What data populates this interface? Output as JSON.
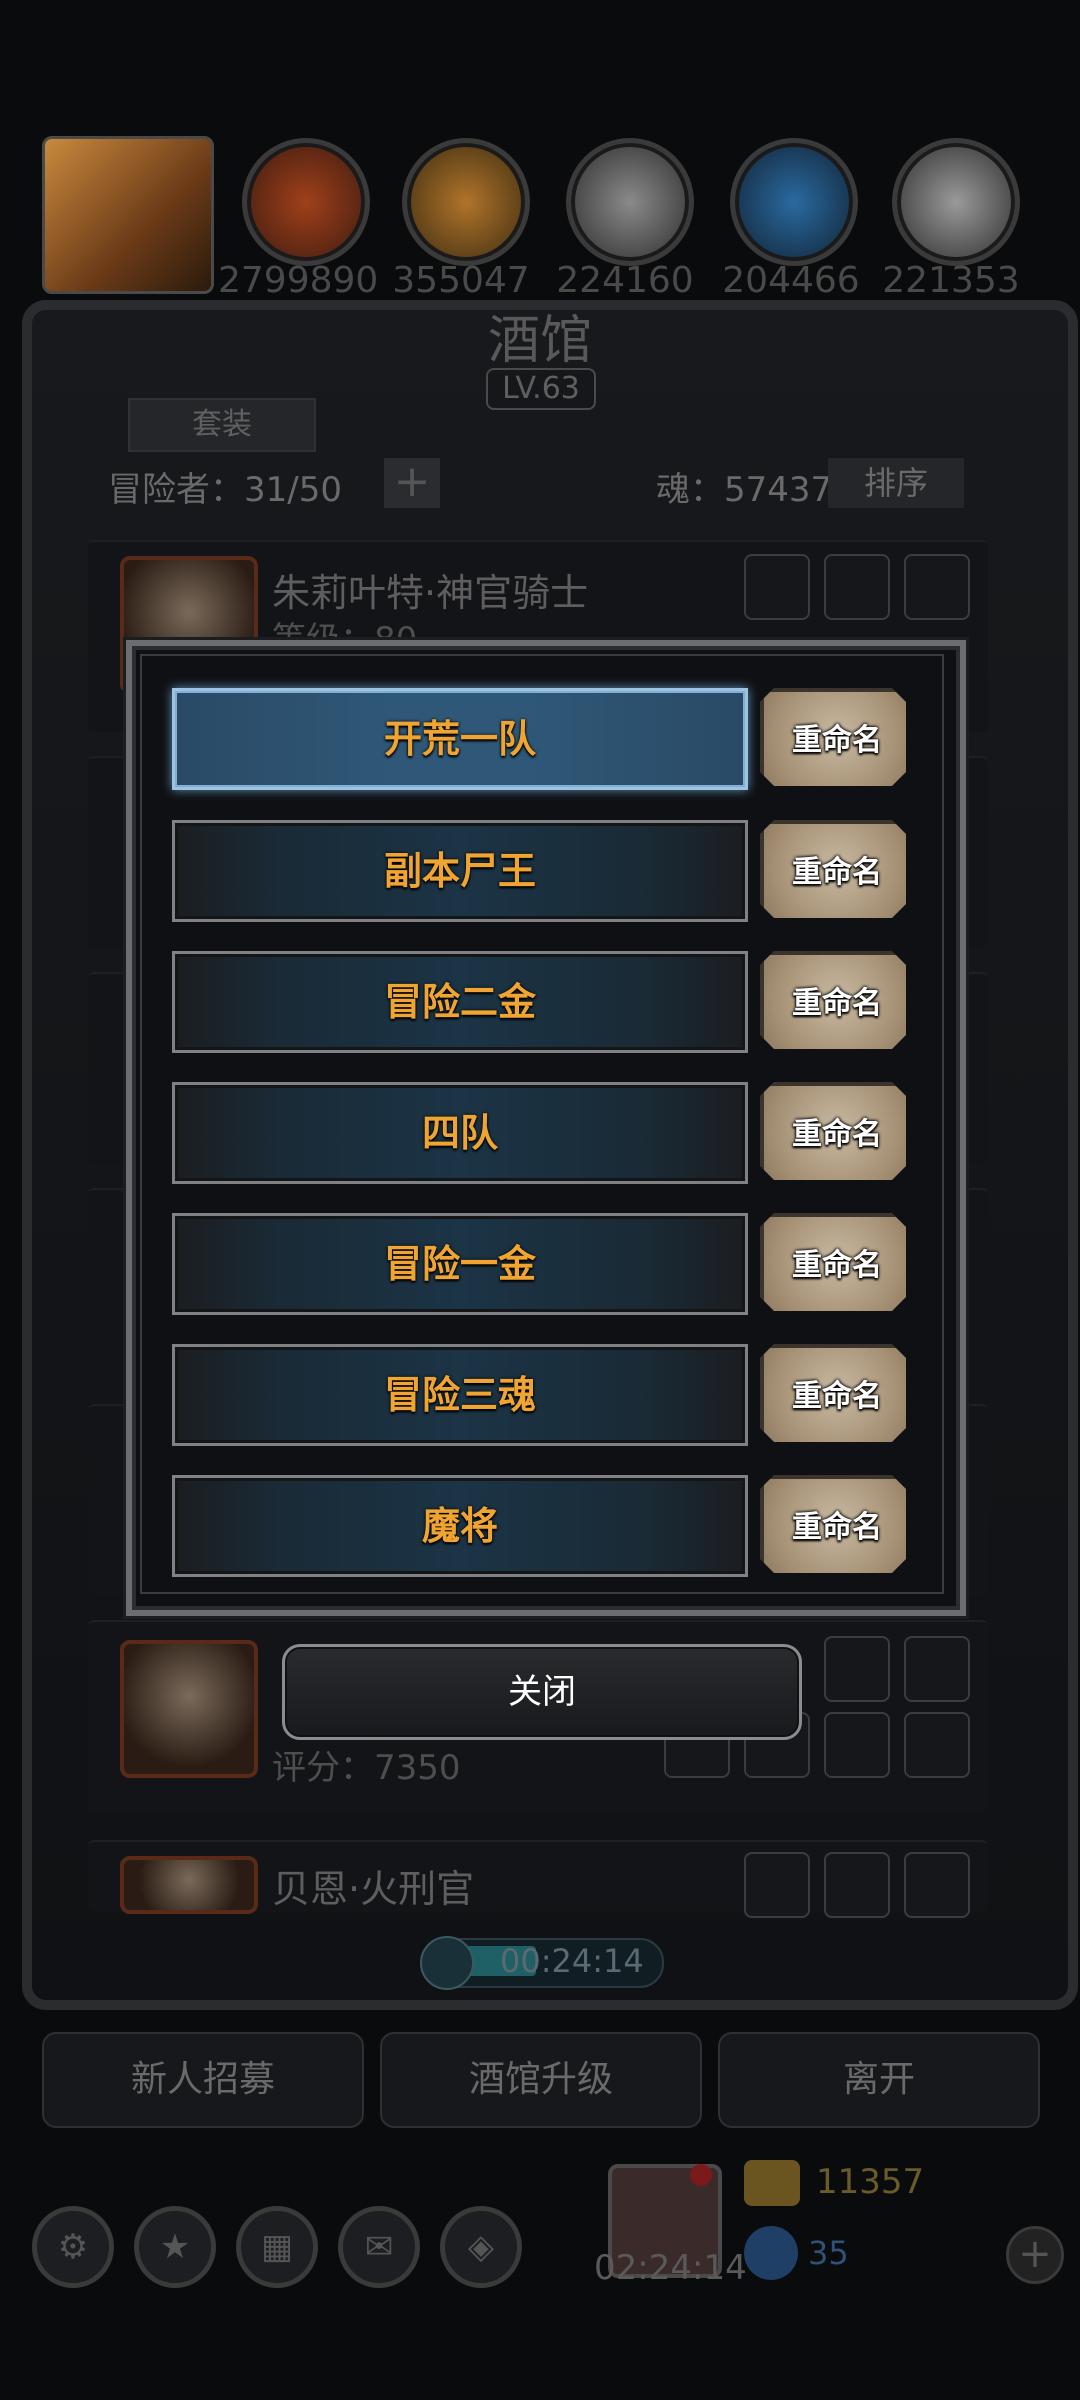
{
  "top_bar": {
    "resources": [
      {
        "icon": "meat-icon",
        "value": "2799890"
      },
      {
        "icon": "wood-icon",
        "value": "355047"
      },
      {
        "icon": "iron-icon",
        "value": "224160"
      },
      {
        "icon": "crystal-icon",
        "value": "204466"
      },
      {
        "icon": "steel-icon",
        "value": "221353"
      }
    ]
  },
  "tavern": {
    "title": "酒馆",
    "level": "LV.63",
    "set_button": "套装",
    "adventurers": "冒险者：31/50",
    "plus": "+",
    "soul": "魂：57437",
    "sort_button": "排序",
    "cards": [
      {
        "name": "朱莉叶特·神官骑士",
        "sub": "等级：80"
      },
      {
        "name": "",
        "sub": "评分：7350"
      },
      {
        "name": "贝恩·火刑官",
        "sub": ""
      }
    ]
  },
  "dialog": {
    "teams": [
      {
        "name": "开荒一队",
        "selected": true
      },
      {
        "name": "副本尸王",
        "selected": false
      },
      {
        "name": "冒险二金",
        "selected": false
      },
      {
        "name": "四队",
        "selected": false
      },
      {
        "name": "冒险一金",
        "selected": false
      },
      {
        "name": "冒险三魂",
        "selected": false
      },
      {
        "name": "魔将",
        "selected": false
      }
    ],
    "rename_label": "重命名",
    "close_label": "关闭"
  },
  "timer": "00:24:14",
  "bottom_buttons": [
    "新人招募",
    "酒馆升级",
    "离开"
  ],
  "gift_timer": "02:24:14",
  "currency": {
    "gold": "11357",
    "gems": "35",
    "add": "+"
  },
  "colors": {
    "team_label": "#f0a532",
    "selected_border": "#9fc3df",
    "rename_button": "#b8a68c"
  }
}
